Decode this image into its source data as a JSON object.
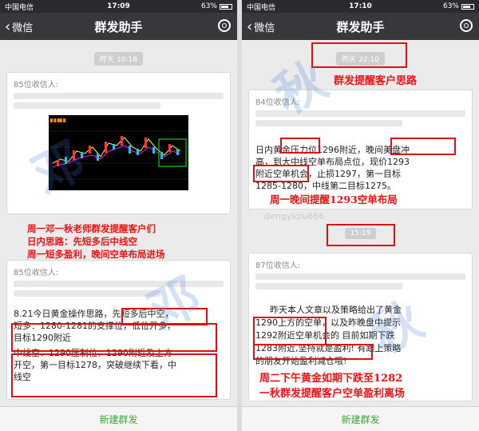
{
  "left_phone": {
    "status": {
      "carrier": "中国电信",
      "time": "17:09",
      "battery": "63%"
    },
    "nav": {
      "back_label": "微信",
      "title": "群发助手"
    },
    "timestamp1": "昨天 10:18",
    "card1": {
      "recipients": "85位收信人:"
    },
    "annotation1": [
      "周一邓一秋老师群发提醒客户们",
      "日内思路：先短多后中线空",
      "周一短多盈利，晚间空单布局进场"
    ],
    "card2": {
      "recipients": "85位收信人:",
      "lines": [
        "8.21今日黄金操作思路，先短多后中空，",
        "短多：1280-1281的支撑位，低位开多，",
        "目标1290附近",
        "中线空：1290压制位，1290附近及上方",
        "开空，第一目标1278，突破继续下看，中",
        "线空"
      ]
    },
    "footer": "新建群发"
  },
  "right_phone": {
    "status": {
      "carrier": "中国电信",
      "time": "17:10",
      "battery": "63%"
    },
    "nav": {
      "back_label": "微信",
      "title": "群发助手"
    },
    "timestamp1": "昨天 22:10",
    "annotation1": "群发提醒客户思路",
    "card1": {
      "recipients": "84位收信人:",
      "lines": [
        "日内黄金压力位1296附近，晚间美盘冲",
        "高，到大中线空单布局点位，现价1293",
        "附近空单机会，止损1297，第一目标",
        "1285-1280，中线第二目标1275。"
      ]
    },
    "annotation2": "周一晚间提醒1293空单布局",
    "timestamp2": "15:19",
    "card2": {
      "recipients": "87位收信人:",
      "lines": [
        "昨天本人文章以及策略给出了黄金",
        "1290上方的空单，以及昨晚盘中提示",
        "1292附近空单机会的     目前如期下跌",
        "1283附近,坚持就是盈利!     有跟上策略",
        "的朋友开始盈利减仓哦!"
      ]
    },
    "annotation3": [
      "周二下午黄金如期下跌至1282",
      "一秋群发提醒客户空单盈利离场"
    ],
    "footer": "新建群发"
  },
  "watermark_text": "dengyiqiu666"
}
